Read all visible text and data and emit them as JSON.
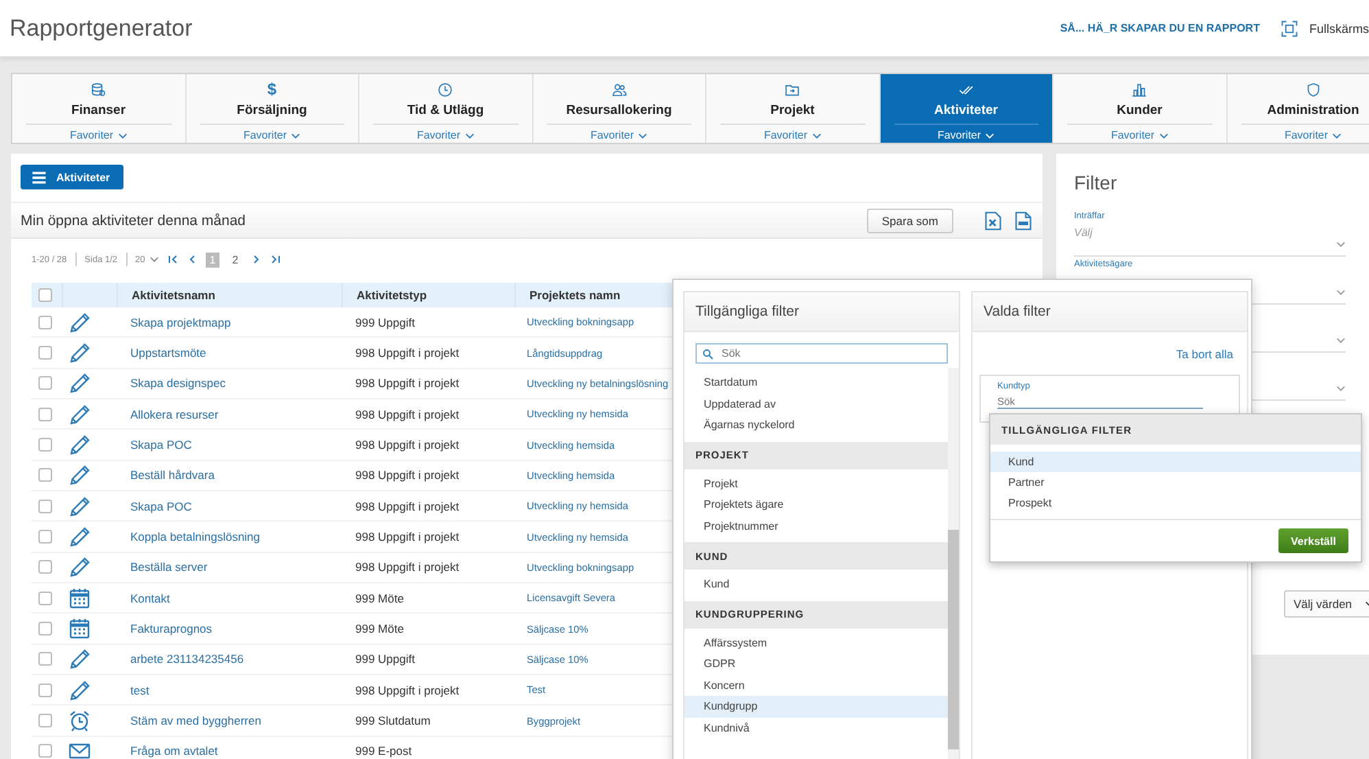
{
  "header": {
    "title": "Rapportgenerator",
    "help_link": "SÅ... HÄ_R SKAPAR DU EN RAPPORT",
    "fullscreen": "Fullskärms"
  },
  "tabs": [
    {
      "label": "Finanser",
      "favorites": "Favoriter",
      "selected": false
    },
    {
      "label": "Försäljning",
      "symbol": "$",
      "favorites": "Favoriter",
      "selected": false
    },
    {
      "label": "Tid & Utlägg",
      "favorites": "Favoriter",
      "selected": false
    },
    {
      "label": "Resursallokering",
      "favorites": "Favoriter",
      "selected": false
    },
    {
      "label": "Projekt",
      "favorites": "Favoriter",
      "selected": false
    },
    {
      "label": "Aktiviteter",
      "favorites": "Favoriter",
      "selected": true
    },
    {
      "label": "Kunder",
      "favorites": "Favoriter",
      "selected": false
    },
    {
      "label": "Administration",
      "favorites": "Favoriter",
      "selected": false
    }
  ],
  "menu_button": "Aktiviteter",
  "report": {
    "title": "Min öppna aktiviteter denna månad",
    "save_button": "Spara som"
  },
  "pagination": {
    "range": "1-20 / 28",
    "page_info": "Sida 1/2",
    "page_size": "20",
    "pages": [
      {
        "label": "1",
        "selected": true
      },
      {
        "label": "2",
        "selected": false
      }
    ]
  },
  "table": {
    "columns": [
      "Aktivitetsnamn",
      "Aktivitetstyp",
      "Projektets namn"
    ],
    "header_checked": false,
    "rows": [
      {
        "kind": "task",
        "checked": false,
        "name": "Skapa projektmapp",
        "type": "999 Uppgift",
        "project": "Utveckling bokningsapp"
      },
      {
        "kind": "task",
        "checked": false,
        "name": "Uppstartsmöte",
        "type": "998 Uppgift i projekt",
        "project": "Långtidsuppdrag"
      },
      {
        "kind": "task",
        "checked": false,
        "name": "Skapa designspec",
        "type": "998 Uppgift i projekt",
        "project": "Utveckling ny betalningslösning"
      },
      {
        "kind": "task",
        "checked": false,
        "name": "Allokera resurser",
        "type": "998 Uppgift i projekt",
        "project": "Utveckling ny hemsida"
      },
      {
        "kind": "task",
        "checked": false,
        "name": "Skapa POC",
        "type": "998 Uppgift i projekt",
        "project": "Utveckling hemsida"
      },
      {
        "kind": "task",
        "checked": false,
        "name": "Beställ hårdvara",
        "type": "998 Uppgift i projekt",
        "project": "Utveckling hemsida"
      },
      {
        "kind": "task",
        "checked": false,
        "name": "Skapa POC",
        "type": "998 Uppgift i projekt",
        "project": "Utveckling ny hemsida"
      },
      {
        "kind": "task",
        "checked": false,
        "name": "Koppla betalningslösning",
        "type": "998 Uppgift i projekt",
        "project": "Utveckling ny hemsida"
      },
      {
        "kind": "task",
        "checked": false,
        "name": "Beställa server",
        "type": "998 Uppgift i projekt",
        "project": "Utveckling bokningsapp"
      },
      {
        "kind": "meeting",
        "checked": false,
        "name": "Kontakt",
        "type": "999 Möte",
        "project": "Licensavgift Severa"
      },
      {
        "kind": "meeting",
        "checked": false,
        "name": "Fakturaprognos",
        "type": "999 Möte",
        "project": "Säljcase 10%"
      },
      {
        "kind": "task",
        "checked": false,
        "name": "arbete 231134235456",
        "type": "999 Uppgift",
        "project": "Säljcase 10%"
      },
      {
        "kind": "task",
        "checked": false,
        "name": "test",
        "type": "998 Uppgift i projekt",
        "project": "Test"
      },
      {
        "kind": "deadline",
        "checked": false,
        "name": "Stäm av med byggherren",
        "type": "999 Slutdatum",
        "project": "Byggprojekt"
      },
      {
        "kind": "email",
        "checked": false,
        "name": "Fråga om avtalet",
        "type": "999 E-post"
      }
    ]
  },
  "filter_panel": {
    "title": "Filter",
    "fields": [
      {
        "kind": "dropdown",
        "label": "Inträffar",
        "value": "Välj"
      },
      {
        "kind": "dropdown",
        "label": "Aktivitetsägare"
      },
      {
        "kind": "dropdown"
      },
      {
        "kind": "dropdown"
      }
    ],
    "values_button": "Välj värden"
  },
  "filter_dialog": {
    "available": {
      "title": "Tillgängliga filter",
      "search_placeholder": "Sök",
      "groups": [
        {
          "items": [
            {
              "label": "Startdatum",
              "selected": false
            },
            {
              "label": "Uppdaterad av",
              "selected": false
            },
            {
              "label": "Ägarnas nyckelord",
              "selected": false
            }
          ]
        },
        {
          "heading": "PROJEKT",
          "items": [
            {
              "label": "Projekt",
              "selected": false
            },
            {
              "label": "Projektets ägare",
              "selected": false
            },
            {
              "label": "Projektnummer",
              "selected": false
            }
          ]
        },
        {
          "heading": "KUND",
          "items": [
            {
              "label": "Kund",
              "selected": false
            }
          ]
        },
        {
          "heading": "KUNDGRUPPERING",
          "items": [
            {
              "label": "Affärssystem",
              "selected": false
            },
            {
              "label": "GDPR",
              "selected": false
            },
            {
              "label": "Koncern",
              "selected": false
            },
            {
              "label": "Kundgrupp",
              "selected": true
            },
            {
              "label": "Kundnivå",
              "selected": false
            }
          ]
        }
      ]
    },
    "chosen": {
      "title": "Valda filter",
      "clear_link": "Ta bort alla",
      "field": {
        "label": "Kundtyp",
        "placeholder": "Sök"
      }
    }
  },
  "options_popup": {
    "title": "TILLGÄNGLIGA FILTER",
    "items": [
      {
        "label": "Kund",
        "selected": true
      },
      {
        "label": "Partner",
        "selected": false
      },
      {
        "label": "Prospekt",
        "selected": false
      }
    ],
    "apply_button": "Verkställ"
  }
}
